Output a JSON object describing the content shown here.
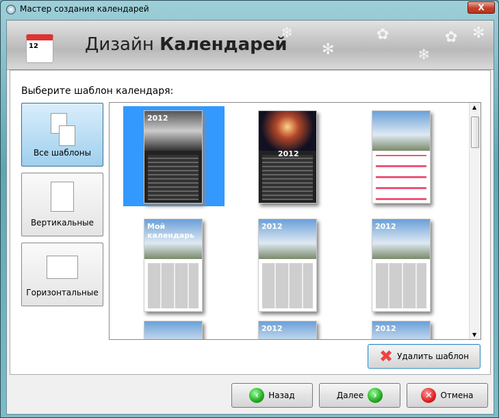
{
  "window": {
    "title": "Мастер создания календарей",
    "close_label": "X"
  },
  "header": {
    "title_light": "Дизайн",
    "title_bold": "Календарей",
    "icon_day": "12"
  },
  "prompt": "Выберите шаблон календаря:",
  "categories": [
    {
      "label": "Все шаблоны",
      "selected": true
    },
    {
      "label": "Вертикальные",
      "selected": false
    },
    {
      "label": "Горизонтальные",
      "selected": false
    }
  ],
  "templates": [
    {
      "caption": "2012",
      "style": "dark",
      "selected": true
    },
    {
      "caption": "2012",
      "style": "dark space",
      "selected": false
    },
    {
      "caption": "",
      "style": "red",
      "selected": false
    },
    {
      "caption": "Мой календарь",
      "style": "",
      "selected": false
    },
    {
      "caption": "2012",
      "style": "",
      "selected": false
    },
    {
      "caption": "2012",
      "style": "",
      "selected": false
    },
    {
      "caption": "",
      "style": "",
      "selected": false
    },
    {
      "caption": "2012",
      "style": "",
      "selected": false
    },
    {
      "caption": "2012",
      "style": "",
      "selected": false
    }
  ],
  "buttons": {
    "delete": "Удалить шаблон",
    "back": "Назад",
    "next": "Далее",
    "cancel": "Отмена"
  }
}
